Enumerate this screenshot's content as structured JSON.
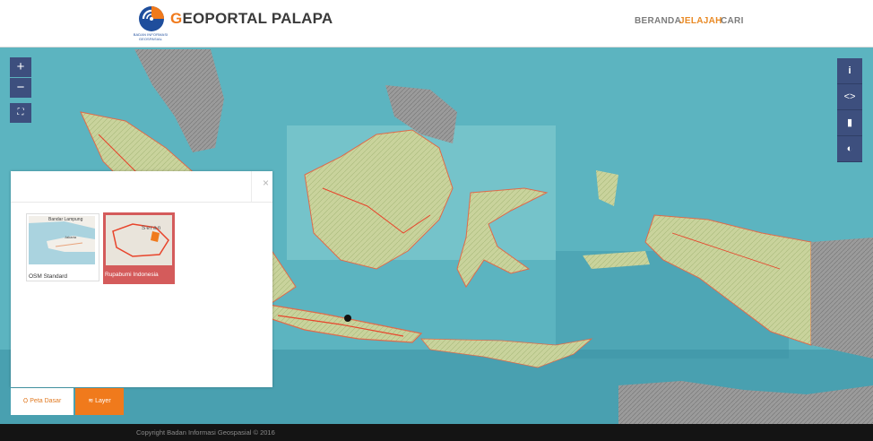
{
  "header": {
    "brand_first_letter": "G",
    "brand_rest": "EOPORTAL PALAPA",
    "brand_sub": "BADAN INFORMASI GEOSPASIAL",
    "nav": [
      {
        "label": "BERANDA",
        "active": false
      },
      {
        "label": "JELAJAH",
        "active": true
      },
      {
        "label": "CARI",
        "active": false
      }
    ]
  },
  "map_controls": {
    "zoom_in": "+",
    "zoom_out": "−",
    "fullscreen": "⛶"
  },
  "right_toolbar": {
    "info": "i",
    "code": "<>",
    "bookmark": "▮",
    "contrast": "◐"
  },
  "panel": {
    "close": "×",
    "basemaps": [
      {
        "label": "OSM Standard",
        "thumb_text_1": "Bandar Lampung",
        "thumb_text_2": "Jakarta",
        "selected": false
      },
      {
        "label": "Rupabumi Indonesia",
        "thumb_text_1": "Seran",
        "selected": true
      }
    ],
    "tabs": {
      "peta_dasar": "⛭ Peta Dasar",
      "layer": "≋ Layer"
    }
  },
  "footer": {
    "copyright": "Copyright Badan Informasi Geospasial © 2016"
  },
  "colors": {
    "accent": "#f07a1c",
    "control_bg": "#3d4f7e",
    "ocean": "#5fb8c2",
    "land": "#c8d29a",
    "selected_card": "#d45b5b"
  }
}
